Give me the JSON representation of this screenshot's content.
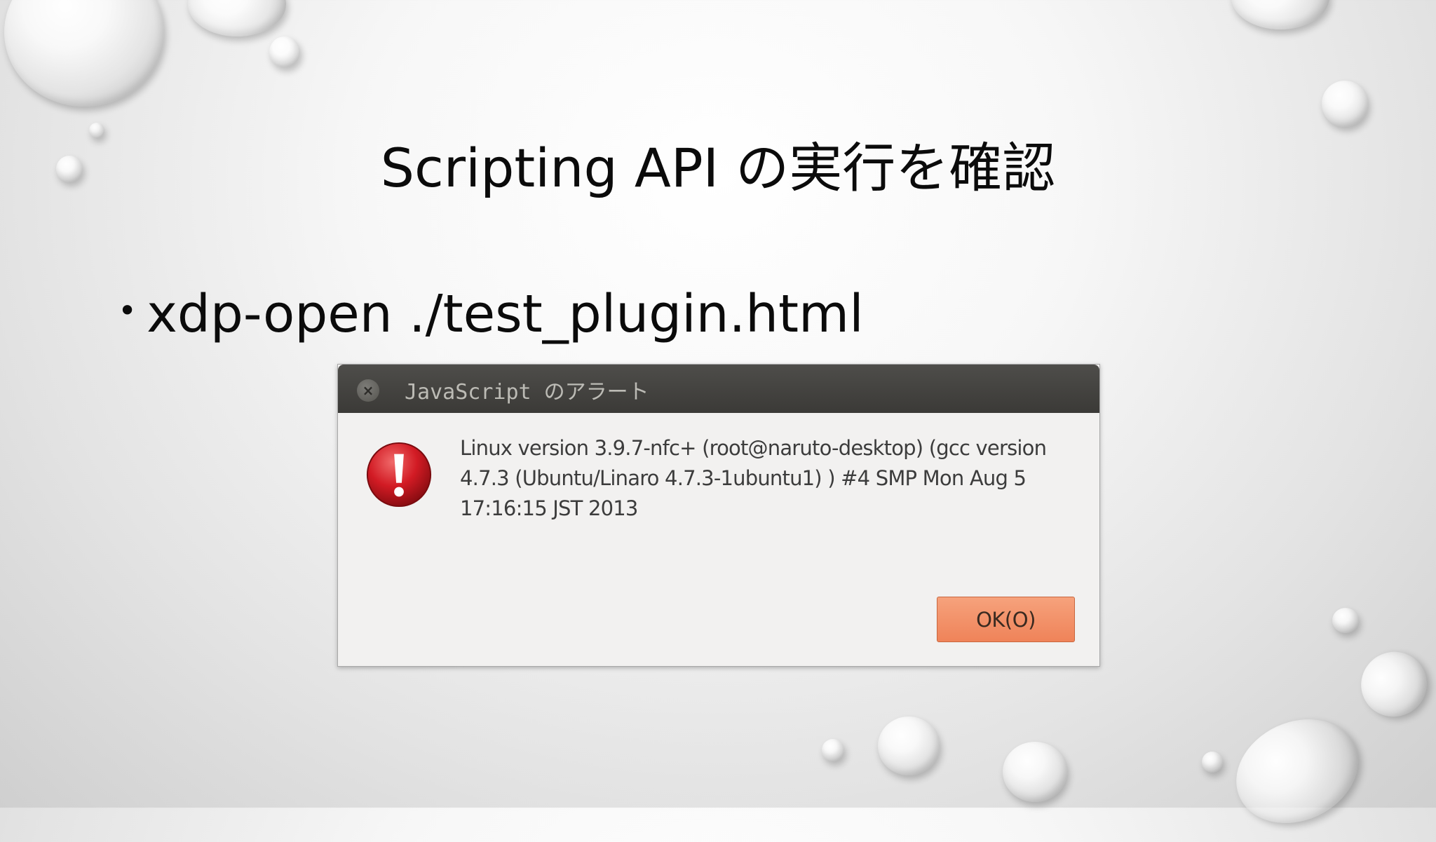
{
  "slide": {
    "title": "Scripting API の実行を確認",
    "bullet": "xdp-open ./test_plugin.html"
  },
  "dialog": {
    "title": "JavaScript のアラート",
    "close_icon": "close-icon",
    "status_icon": "error-icon",
    "message": "Linux version 3.9.7-nfc+ (root@naruto-desktop) (gcc version 4.7.3 (Ubuntu/Linaro 4.7.3-1ubuntu1) ) #4 SMP Mon Aug 5 17:16:15 JST 2013",
    "ok_label": "OK(O)"
  },
  "colors": {
    "titlebar": "#3b3a37",
    "ok_button": "#ef8359",
    "error_icon": "#d21b24"
  }
}
